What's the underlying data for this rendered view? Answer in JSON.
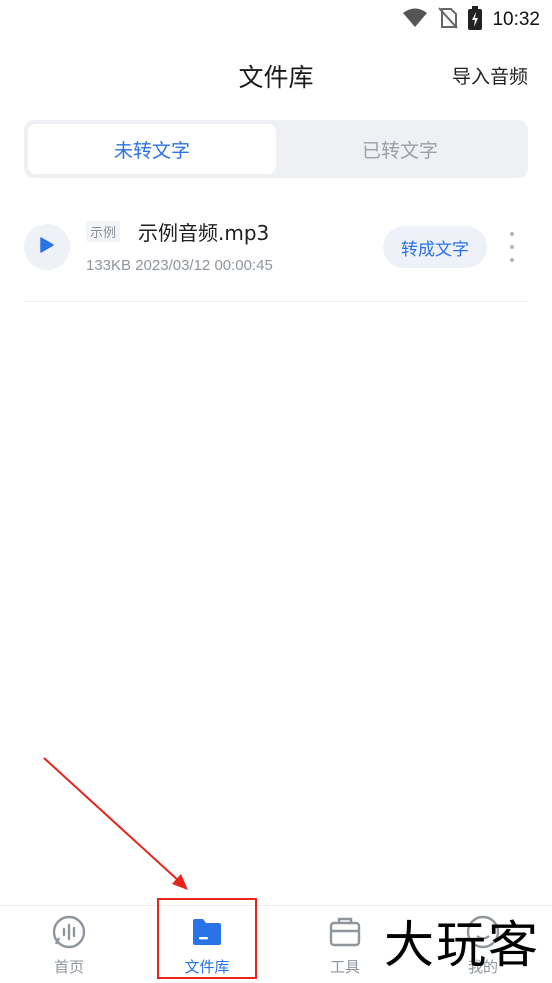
{
  "status_bar": {
    "time": "10:32",
    "icons": [
      "wifi-icon",
      "no-sim-icon",
      "battery-charging-icon"
    ]
  },
  "header": {
    "title": "文件库",
    "import_label": "导入音频"
  },
  "tabs": [
    {
      "label": "未转文字",
      "active": true
    },
    {
      "label": "已转文字",
      "active": false
    }
  ],
  "files": [
    {
      "tag": "示例",
      "name": "示例音频.mp3",
      "meta": "133KB 2023/03/12 00:00:45",
      "convert_label": "转成文字"
    }
  ],
  "bottom_nav": [
    {
      "label": "首页",
      "icon": "voice-wave-icon",
      "active": false
    },
    {
      "label": "文件库",
      "icon": "folder-icon",
      "active": true
    },
    {
      "label": "工具",
      "icon": "toolbox-icon",
      "active": false
    },
    {
      "label": "我的",
      "icon": "profile-icon",
      "active": false
    }
  ],
  "watermark": "大玩客",
  "colors": {
    "accent": "#2a72e8",
    "annotation": "#e8231b"
  }
}
